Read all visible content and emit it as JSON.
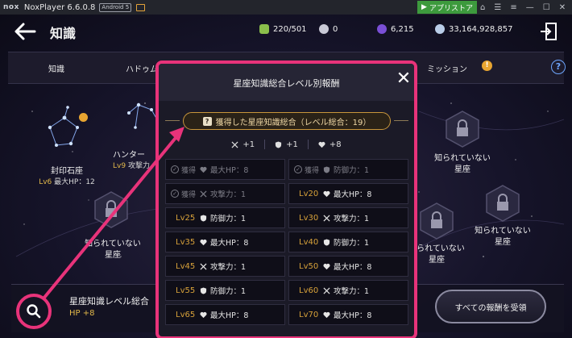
{
  "titlebar": {
    "app_name": "NoxPlayer 6.6.0.8",
    "android": "Android 5",
    "store_label": "アプリストア"
  },
  "header": {
    "title": "知識",
    "resources": [
      {
        "name": "material",
        "value": "220/501",
        "color": "#8bbf4b"
      },
      {
        "name": "orb",
        "value": "0",
        "color": "#c9c9d6"
      },
      {
        "name": "gem",
        "value": "6,215",
        "color": "#7a4fd6"
      },
      {
        "name": "coin",
        "value": "33,164,928,857",
        "color": "#b9cde8"
      }
    ]
  },
  "tabs": {
    "knowledge": "知識",
    "hadoum": "ハドゥム",
    "mission": "ミッション"
  },
  "constellations": {
    "sealstone_name": "封印石座",
    "sealstone_lv": "Lv6",
    "sealstone_stat": "最大HP：12",
    "hunter_name": "ハンター",
    "hunter_lv": "Lv9",
    "hunter_stat": "攻撃力",
    "unknown_1": "知られていない",
    "unknown_2": "星座"
  },
  "bottom": {
    "summary_title": "星座知識レベル総合",
    "summary_stat": "HP +8",
    "claim_all": "すべての報酬を受領"
  },
  "modal": {
    "title": "星座知識総合レベル別報酬",
    "total_label": "獲得した星座知識総合（レベル総合：19）",
    "totals": [
      {
        "icon": "sword-icon",
        "value": "+1"
      },
      {
        "icon": "shield-icon",
        "value": "+1"
      },
      {
        "icon": "heart-icon",
        "value": "+8"
      }
    ],
    "claimed_label": "獲得",
    "rewards": [
      {
        "claimed": true,
        "lv": "",
        "icon": "heart-icon",
        "text": "最大HP：8"
      },
      {
        "claimed": true,
        "lv": "",
        "icon": "shield-icon",
        "text": "防御力：1"
      },
      {
        "claimed": true,
        "lv": "",
        "icon": "sword-icon",
        "text": "攻撃力：1"
      },
      {
        "claimed": false,
        "lv": "Lv20",
        "icon": "heart-icon",
        "text": "最大HP：8"
      },
      {
        "claimed": false,
        "lv": "Lv25",
        "icon": "shield-icon",
        "text": "防御力：1"
      },
      {
        "claimed": false,
        "lv": "Lv30",
        "icon": "sword-icon",
        "text": "攻撃力：1"
      },
      {
        "claimed": false,
        "lv": "Lv35",
        "icon": "heart-icon",
        "text": "最大HP：8"
      },
      {
        "claimed": false,
        "lv": "Lv40",
        "icon": "shield-icon",
        "text": "防御力：1"
      },
      {
        "claimed": false,
        "lv": "Lv45",
        "icon": "sword-icon",
        "text": "攻撃力：1"
      },
      {
        "claimed": false,
        "lv": "Lv50",
        "icon": "heart-icon",
        "text": "最大HP：8"
      },
      {
        "claimed": false,
        "lv": "Lv55",
        "icon": "shield-icon",
        "text": "防御力：1"
      },
      {
        "claimed": false,
        "lv": "Lv60",
        "icon": "sword-icon",
        "text": "攻撃力：1"
      },
      {
        "claimed": false,
        "lv": "Lv65",
        "icon": "heart-icon",
        "text": "最大HP：8"
      },
      {
        "claimed": false,
        "lv": "Lv70",
        "icon": "heart-icon",
        "text": "最大HP：8"
      }
    ]
  },
  "colors": {
    "accent": "#e8337a",
    "gold": "#d8a23a",
    "store_green": "#3d9a3d"
  }
}
